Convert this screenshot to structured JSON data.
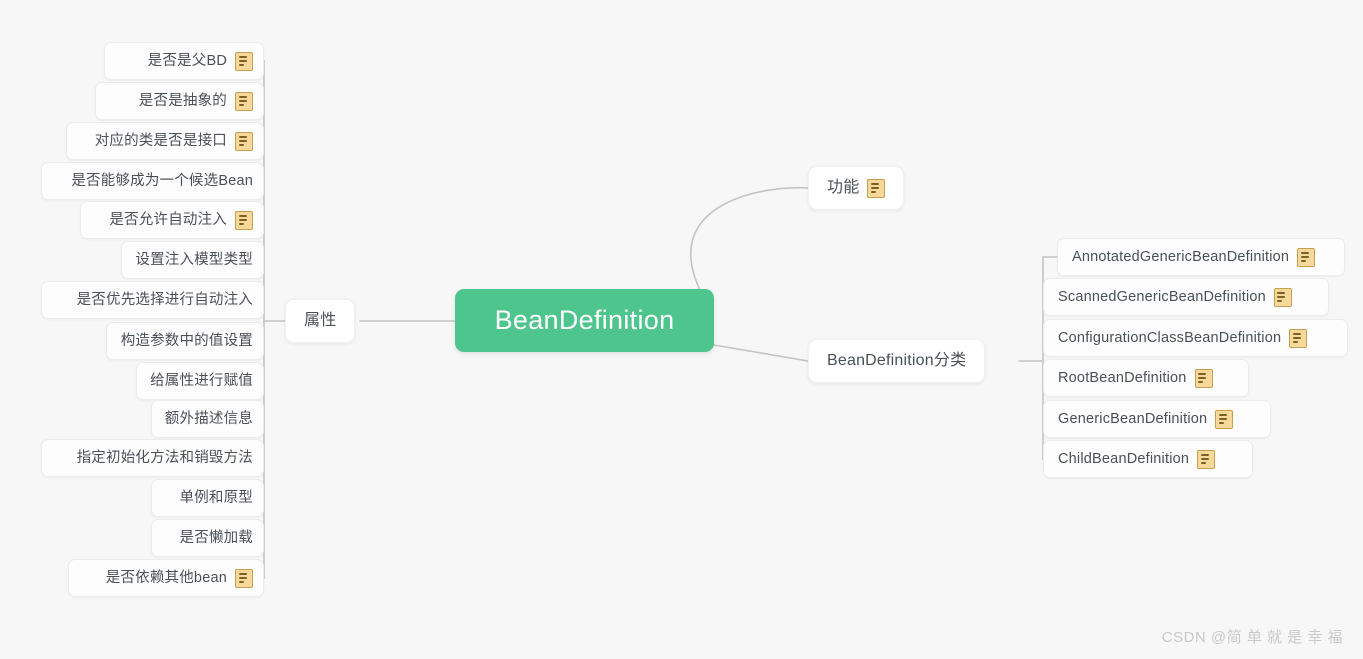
{
  "canvas": {
    "background_color": "#f7f7f7",
    "line_color": "#c4c4c4"
  },
  "root": {
    "label": "BeanDefinition",
    "color": "#4ec58d",
    "text_color": "#ffffff"
  },
  "branches": [
    {
      "id": "attributes",
      "label": "属性",
      "side": "left",
      "has_note_icon": false
    },
    {
      "id": "function",
      "label": "功能",
      "side": "right",
      "has_note_icon": true
    },
    {
      "id": "classification",
      "label": "BeanDefinition分类",
      "side": "right",
      "has_note_icon": false
    }
  ],
  "attributes_children": [
    {
      "label": "是否是父BD",
      "has_note_icon": true
    },
    {
      "label": "是否是抽象的",
      "has_note_icon": true
    },
    {
      "label": "对应的类是否是接口",
      "has_note_icon": true
    },
    {
      "label": "是否能够成为一个候选Bean",
      "has_note_icon": false
    },
    {
      "label": "是否允许自动注入",
      "has_note_icon": true
    },
    {
      "label": "设置注入模型类型",
      "has_note_icon": false
    },
    {
      "label": "是否优先选择进行自动注入",
      "has_note_icon": false
    },
    {
      "label": "构造参数中的值设置",
      "has_note_icon": false
    },
    {
      "label": "给属性进行赋值",
      "has_note_icon": false
    },
    {
      "label": "额外描述信息",
      "has_note_icon": false
    },
    {
      "label": "指定初始化方法和销毁方法",
      "has_note_icon": false
    },
    {
      "label": "单例和原型",
      "has_note_icon": false
    },
    {
      "label": "是否懒加载",
      "has_note_icon": false
    },
    {
      "label": "是否依赖其他bean",
      "has_note_icon": true
    }
  ],
  "classification_children": [
    {
      "label": "AnnotatedGenericBeanDefinition",
      "has_note_icon": true
    },
    {
      "label": "ScannedGenericBeanDefinition",
      "has_note_icon": true
    },
    {
      "label": "ConfigurationClassBeanDefinition",
      "has_note_icon": true
    },
    {
      "label": "RootBeanDefinition",
      "has_note_icon": true
    },
    {
      "label": "GenericBeanDefinition",
      "has_note_icon": true
    },
    {
      "label": "ChildBeanDefinition",
      "has_note_icon": true
    }
  ],
  "watermark": {
    "text": "CSDN @简 单 就 是 幸 福"
  },
  "icons": {
    "note": "note-icon"
  }
}
